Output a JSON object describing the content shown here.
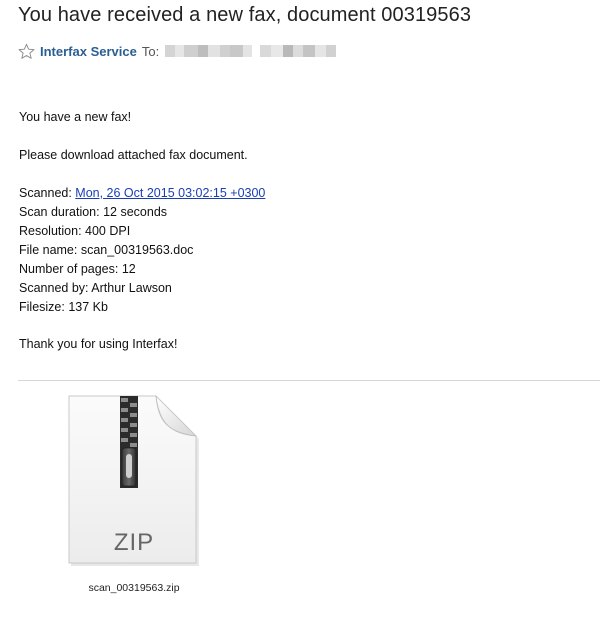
{
  "email": {
    "subject": "You have received a new fax, document 00319563",
    "sender": "Interfax Service",
    "to_label": "To:"
  },
  "body": {
    "greeting": "You have a new fax!",
    "instruction": "Please download attached fax document.",
    "scanned_label": "Scanned: ",
    "scanned_value": "Mon, 26 Oct 2015 03:02:15 +0300",
    "scan_duration": "Scan duration: 12 seconds",
    "resolution": "Resolution: 400 DPI",
    "file_name": "File name: scan_00319563.doc",
    "pages": "Number of pages: 12",
    "scanned_by": "Scanned by: Arthur Lawson",
    "filesize": "Filesize: 137 Kb",
    "thanks": "Thank you for using Interfax!"
  },
  "attachment": {
    "type_label": "ZIP",
    "filename": "scan_00319563.zip",
    "icon": "zip-file-icon"
  },
  "colors": {
    "sender": "#2a5f93",
    "link": "#1a3fb5",
    "divider": "#d8d8d8"
  }
}
